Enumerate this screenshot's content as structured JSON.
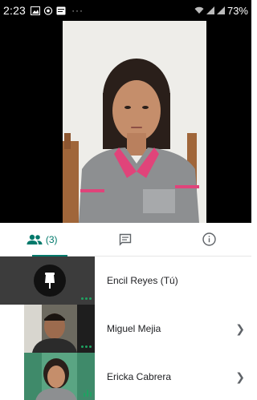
{
  "status_bar": {
    "time": "2:23",
    "dots": "···",
    "battery": "73%"
  },
  "tabs": {
    "people_count": "(3)"
  },
  "participants": [
    {
      "name": "Encil Reyes (Tú)"
    },
    {
      "name": "Miguel Mejia"
    },
    {
      "name": "Ericka Cabrera"
    }
  ],
  "colors": {
    "accent": "#00796b",
    "speaking": "#1ea362",
    "shirt": "#8d8f91",
    "collar": "#e0447a"
  },
  "icons": {
    "people_tab": "people-icon",
    "chat_tab": "chat-icon",
    "info_tab": "info-icon",
    "self_tile": "pin-icon"
  }
}
